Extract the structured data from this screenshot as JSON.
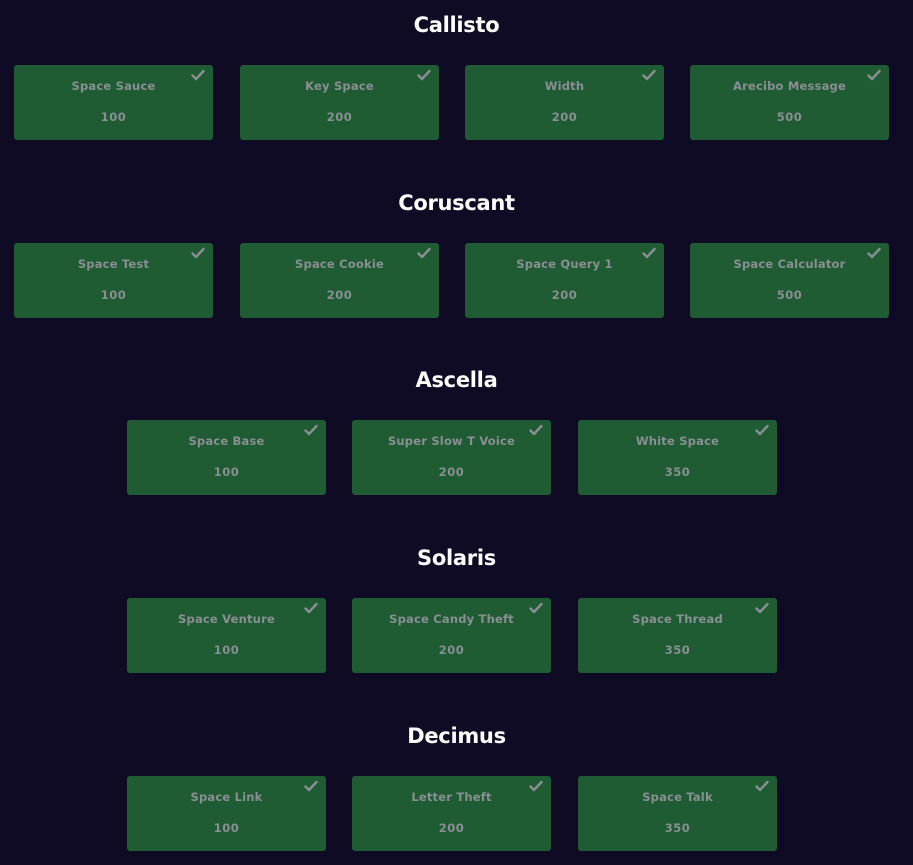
{
  "colors": {
    "background": "#0f0b24",
    "card_bg": "#1f5c34",
    "card_text": "#8a8f93",
    "title_text": "#ffffff"
  },
  "categories": [
    {
      "name": "Callisto",
      "challenges": [
        {
          "name": "Space Sauce",
          "points": "100",
          "solved": true,
          "icon": "check-icon"
        },
        {
          "name": "Key Space",
          "points": "200",
          "solved": true,
          "icon": "check-icon"
        },
        {
          "name": "Width",
          "points": "200",
          "solved": true,
          "icon": "check-icon"
        },
        {
          "name": "Arecibo Message",
          "points": "500",
          "solved": true,
          "icon": "check-icon"
        }
      ]
    },
    {
      "name": "Coruscant",
      "challenges": [
        {
          "name": "Space Test",
          "points": "100",
          "solved": true,
          "icon": "check-icon"
        },
        {
          "name": "Space Cookie",
          "points": "200",
          "solved": true,
          "icon": "check-icon"
        },
        {
          "name": "Space Query 1",
          "points": "200",
          "solved": true,
          "icon": "check-icon"
        },
        {
          "name": "Space Calculator",
          "points": "500",
          "solved": true,
          "icon": "check-icon"
        }
      ]
    },
    {
      "name": "Ascella",
      "challenges": [
        {
          "name": "Space Base",
          "points": "100",
          "solved": true,
          "icon": "check-icon"
        },
        {
          "name": "Super Slow T Voice",
          "points": "200",
          "solved": true,
          "icon": "check-icon"
        },
        {
          "name": "White Space",
          "points": "350",
          "solved": true,
          "icon": "check-icon"
        }
      ]
    },
    {
      "name": "Solaris",
      "challenges": [
        {
          "name": "Space Venture",
          "points": "100",
          "solved": true,
          "icon": "check-icon"
        },
        {
          "name": "Space Candy Theft",
          "points": "200",
          "solved": true,
          "icon": "check-icon"
        },
        {
          "name": "Space Thread",
          "points": "350",
          "solved": true,
          "icon": "check-icon"
        }
      ]
    },
    {
      "name": "Decimus",
      "challenges": [
        {
          "name": "Space Link",
          "points": "100",
          "solved": true,
          "icon": "check-icon"
        },
        {
          "name": "Letter Theft",
          "points": "200",
          "solved": true,
          "icon": "check-icon"
        },
        {
          "name": "Space Talk",
          "points": "350",
          "solved": true,
          "icon": "check-icon"
        }
      ]
    }
  ]
}
